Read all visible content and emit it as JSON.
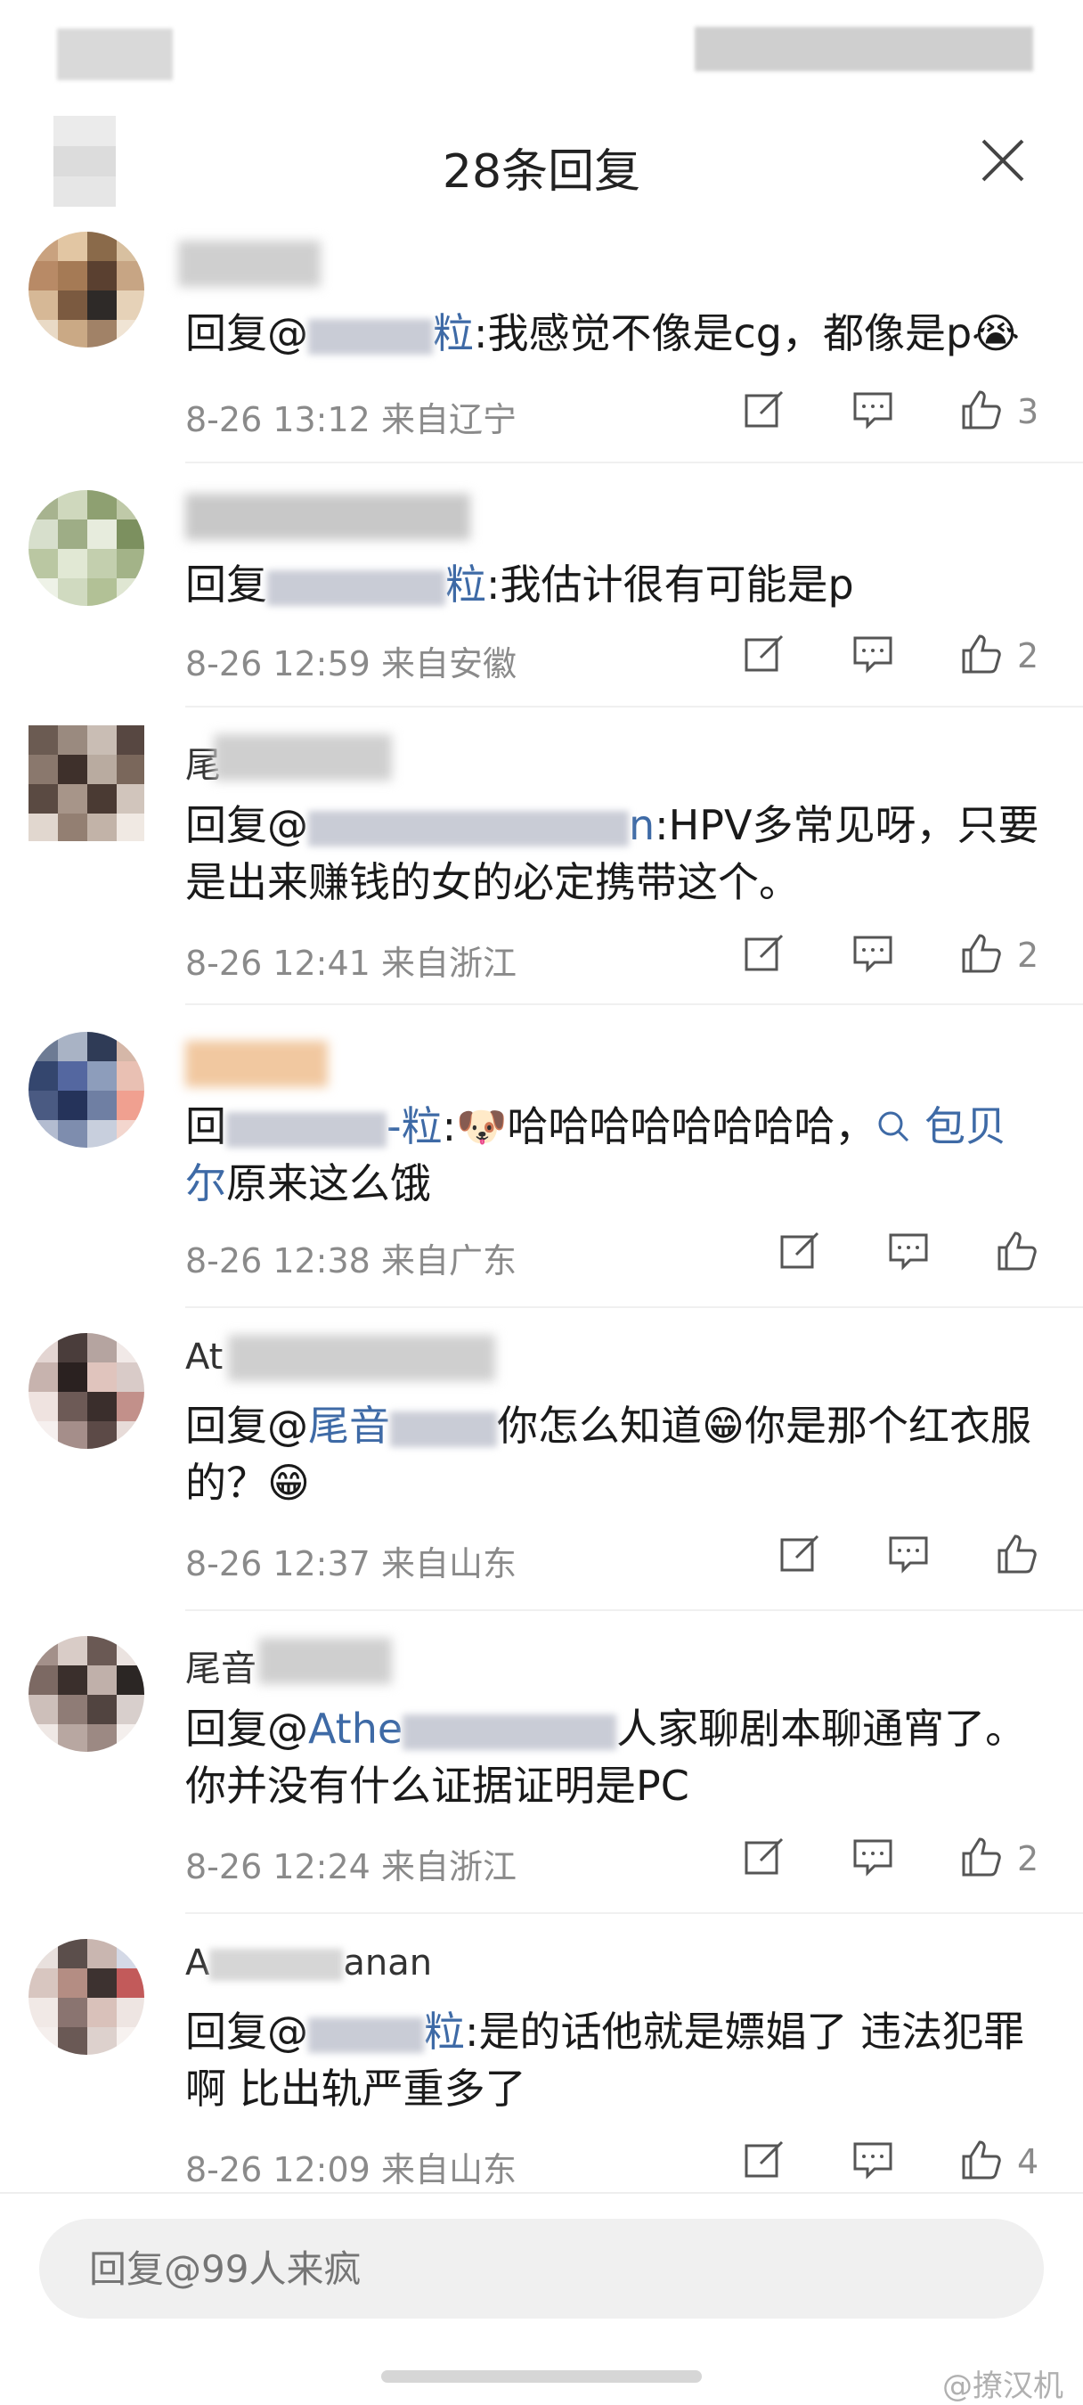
{
  "header": {
    "title": "28条回复"
  },
  "comments": [
    {
      "nick": "",
      "content_prefix": "回复@",
      "mention_tail": "粒",
      "content": ":我感觉不像是cg，都像是p😭",
      "time": "8-26 13:12",
      "location": "来自辽宁",
      "likes": "3"
    },
    {
      "nick": "",
      "content_prefix": "回复",
      "mention_tail": "粒",
      "content": ":我估计很有可能是p",
      "time": "8-26 12:59",
      "location": "来自安徽",
      "likes": "2"
    },
    {
      "nick": "尾",
      "content_prefix": "回复@",
      "mention_tail": "n",
      "content": ":HPV多常见呀，只要是出来赚钱的女的必定携带这个。",
      "time": "8-26 12:41",
      "location": "来自浙江",
      "likes": "2"
    },
    {
      "nick": "",
      "content_prefix": "回",
      "mention_tail": "-粒",
      "content": ":🐶哈哈哈哈哈哈哈哈，",
      "topic": "包贝尔",
      "content_after": "原来这么饿",
      "time": "8-26 12:38",
      "location": "来自广东",
      "likes": ""
    },
    {
      "nick": "At",
      "content_prefix": "回复@",
      "mention_tail": "尾音",
      "content": "你怎么知道😁你是那个红衣服的？😁",
      "time": "8-26 12:37",
      "location": "来自山东",
      "likes": ""
    },
    {
      "nick": "尾音",
      "content_prefix": "回复@",
      "mention_tail": "Athe",
      "content": "人家聊剧本聊通宵了。你并没有什么证据证明是PC",
      "time": "8-26 12:24",
      "location": "来自浙江",
      "likes": "2"
    },
    {
      "nick": "A",
      "nick_tail": "anan",
      "content_prefix": "回复@",
      "mention_tail": "粒",
      "content": ":是的话他就是嫖娼了 违法犯罪啊 比出轨严重多了",
      "time": "8-26 12:09",
      "location": "来自山东",
      "likes": "4"
    }
  ],
  "reply_box": {
    "placeholder": "回复@99人来疯"
  },
  "watermark": "@撩汉机",
  "icons": [
    "close-icon",
    "edit-icon",
    "comment-icon",
    "like-icon",
    "search-icon"
  ],
  "colors": {
    "mention": "#3e6aa6",
    "meta": "#8a8a8a",
    "input_bg": "#f0f0f0"
  }
}
